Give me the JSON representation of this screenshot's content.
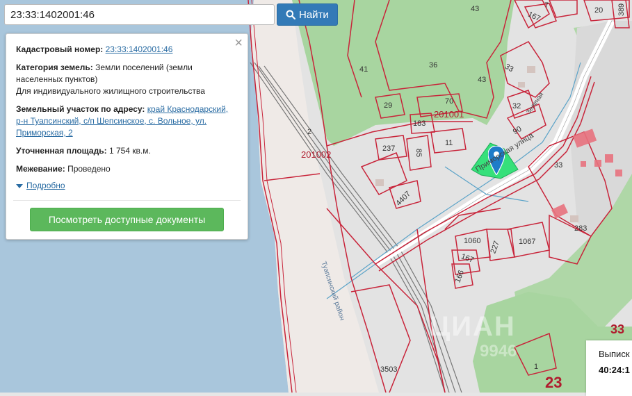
{
  "search": {
    "value": "23:33:1402001:46",
    "button_label": "Найти"
  },
  "info": {
    "cadastral_label": "Кадастровый номер:",
    "cadastral_value": "23:33:1402001:46",
    "category_label": "Категория земель:",
    "category_value": "Земли поселений (земли населенных пунктов)",
    "usage": "Для индивидуального жилищного строительства",
    "address_label": "Земельный участок по адресу:",
    "address_value": "край Краснодарский, р-н Туапсинский, с/п Шепсинское, с. Вольное, ул. Приморская, 2",
    "area_label": "Уточненная площадь:",
    "area_value": "1 754 кв.м.",
    "survey_label": "Межевание:",
    "survey_value": "Проведено",
    "details_label": "Подробно",
    "docs_button": "Посмотреть доступные документы",
    "close_symbol": "×"
  },
  "map": {
    "plot_numbers": [
      "43",
      "7",
      "167",
      "20",
      "389",
      "41",
      "36",
      "33",
      "43",
      "70",
      "29",
      "32",
      "201001",
      "183",
      "90",
      "237",
      "85",
      "11",
      "33",
      "201002",
      "2",
      "4407",
      "283",
      "1060",
      "227",
      "1067",
      "167",
      "166",
      "3503",
      "1"
    ],
    "street_label": "Приморская улица",
    "street_label2": "Зеленая",
    "region_label": "Туапсинский район",
    "big_numbers": [
      "33",
      "23"
    ],
    "marker": "map-pin-icon"
  },
  "extract": {
    "title": "Выписк",
    "number": "40:24:1"
  },
  "watermark": {
    "text": "ЦИАН",
    "text2": "9946"
  }
}
